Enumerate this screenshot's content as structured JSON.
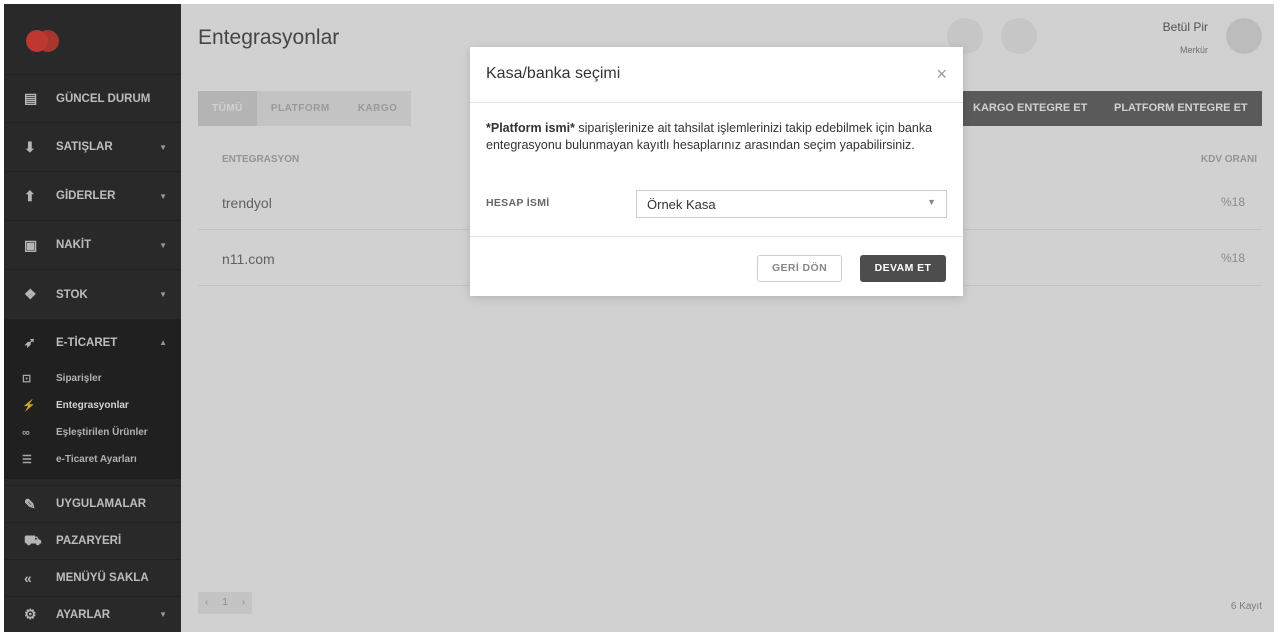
{
  "sidebar": {
    "items": [
      {
        "label": "GÜNCEL DURUM",
        "icon": "dashboard-icon",
        "glyph": "▤",
        "chevron": ""
      },
      {
        "label": "SATIŞLAR",
        "icon": "download-icon",
        "glyph": "⬇",
        "chevron": "▼"
      },
      {
        "label": "GİDERLER",
        "icon": "upload-icon",
        "glyph": "⬆",
        "chevron": "▼"
      },
      {
        "label": "NAKİT",
        "icon": "cash-icon",
        "glyph": "▣",
        "chevron": "▼"
      },
      {
        "label": "STOK",
        "icon": "cubes-icon",
        "glyph": "❖",
        "chevron": "▼"
      },
      {
        "label": "E-TİCARET",
        "icon": "rocket-icon",
        "glyph": "➶",
        "chevron": "▲"
      }
    ],
    "ecommerce_sub": [
      {
        "label": "Siparişler",
        "icon": "bag-icon",
        "glyph": "⊡"
      },
      {
        "label": "Entegrasyonlar",
        "icon": "plug-icon",
        "glyph": "⚡"
      },
      {
        "label": "Eşleştirilen Ürünler",
        "icon": "link-icon",
        "glyph": "∞"
      },
      {
        "label": "e-Ticaret Ayarları",
        "icon": "sliders-icon",
        "glyph": "☰"
      }
    ],
    "bottom": [
      {
        "label": "UYGULAMALAR",
        "icon": "apps-icon",
        "glyph": "✎",
        "chevron": ""
      },
      {
        "label": "PAZARYERİ",
        "icon": "cart-icon",
        "glyph": "⛟",
        "chevron": ""
      },
      {
        "label": "MENÜYÜ SAKLA",
        "icon": "collapse-icon",
        "glyph": "«",
        "chevron": ""
      },
      {
        "label": "AYARLAR",
        "icon": "gear-icon",
        "glyph": "⚙",
        "chevron": "▼"
      }
    ]
  },
  "header": {
    "title": "Entegrasyonlar",
    "user_name": "Betül Pir",
    "user_org": "Merkür"
  },
  "tabs": [
    "TÜMÜ",
    "PLATFORM",
    "KARGO"
  ],
  "actions": {
    "kargo": "KARGO ENTEGRE ET",
    "platform": "PLATFORM ENTEGRE ET"
  },
  "table": {
    "col_integration": "ENTEGRASYON",
    "col_kdv": "KDV ORANI",
    "rows": [
      {
        "name": "trendyol",
        "kdv": "%18"
      },
      {
        "name": "n11.com",
        "kdv": "%18"
      }
    ]
  },
  "pager": {
    "prev": "‹",
    "page": "1",
    "next": "›",
    "count": "6 Kayıt"
  },
  "modal": {
    "title": "Kasa/banka seçimi",
    "close": "×",
    "text_bold": "*Platform ismi*",
    "text_rest": " siparişlerinize ait tahsilat işlemlerinizi takip edebilmek için banka entegrasyonu bulunmayan kayıtlı hesaplarınız arasından seçim yapabilirsiniz.",
    "field_label": "HESAP İSMİ",
    "select_value": "Örnek Kasa",
    "back_label": "GERİ DÖN",
    "next_label": "DEVAM ET"
  },
  "colors": {
    "brand": "#e8453c",
    "sidebar": "#333333",
    "primary_button": "#4d4d4d"
  }
}
